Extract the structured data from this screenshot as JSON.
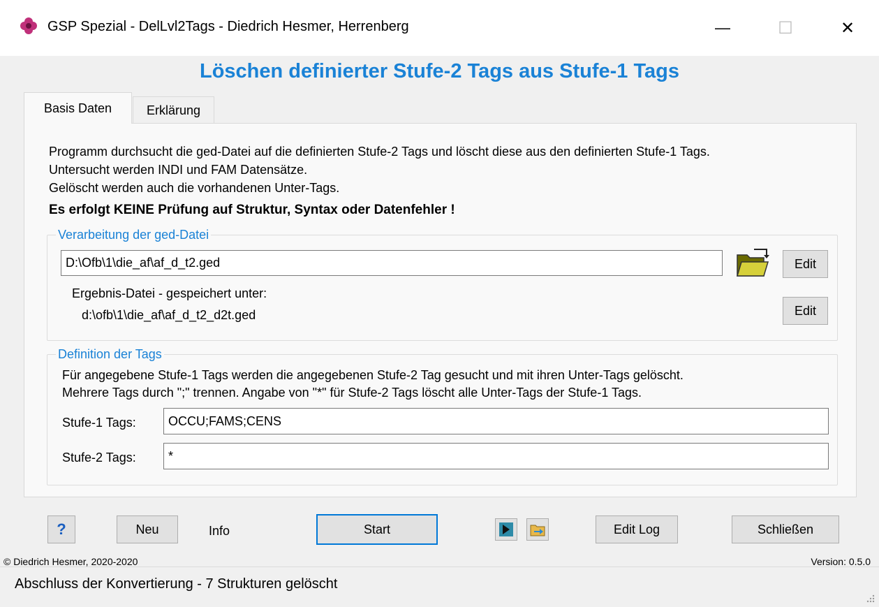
{
  "window": {
    "title": "GSP Spezial - DelLvl2Tags  -  Diedrich Hesmer, Herrenberg",
    "minimize": "—",
    "maximize": "☐",
    "close": "✕"
  },
  "heading": "Löschen definierter Stufe-2 Tags aus Stufe-1 Tags",
  "tabs": [
    {
      "label": "Basis Daten",
      "selected": true
    },
    {
      "label": "Erklärung",
      "selected": false
    }
  ],
  "description": {
    "line1": "Programm durchsucht die ged-Datei auf die definierten Stufe-2 Tags und löscht diese aus den definierten Stufe-1 Tags.",
    "line2": "Untersucht werden INDI und FAM Datensätze.",
    "line3": "Gelöscht werden auch die vorhandenen Unter-Tags.",
    "warning": "Es erfolgt KEINE Prüfung auf Struktur, Syntax oder Datenfehler !"
  },
  "ged_group": {
    "legend": "Verarbeitung der ged-Datei",
    "file_path": "D:\\Ofb\\1\\die_af\\af_d_t2.ged",
    "edit_label": "Edit",
    "result_label": "Ergebnis-Datei - gespeichert unter:",
    "result_path": "d:\\ofb\\1\\die_af\\af_d_t2_d2t.ged",
    "result_edit_label": "Edit"
  },
  "tags_group": {
    "legend": "Definition der Tags",
    "help1": "Für angegebene Stufe-1 Tags werden die angegebenen Stufe-2 Tag gesucht und mit ihren Unter-Tags gelöscht.",
    "help2": "Mehrere Tags durch \";\" trennen. Angabe von \"*\" für Stufe-2 Tags löscht alle Unter-Tags der Stufe-1 Tags.",
    "level1_label": "Stufe-1 Tags:",
    "level1_value": "OCCU;FAMS;CENS",
    "level2_label": "Stufe-2 Tags:",
    "level2_value": "*"
  },
  "buttons": {
    "help": "?",
    "new": "Neu",
    "info": "Info",
    "start": "Start",
    "edit_log": "Edit Log",
    "close": "Schließen"
  },
  "footer": {
    "copyright": "© Diedrich Hesmer,  2020-2020",
    "version": "Version: 0.5.0"
  },
  "status": "Abschluss der Konvertierung - 7 Strukturen gelöscht",
  "colors": {
    "accent": "#1a82d6",
    "panel": "#f9f9f9",
    "window": "#f0f0f0"
  }
}
